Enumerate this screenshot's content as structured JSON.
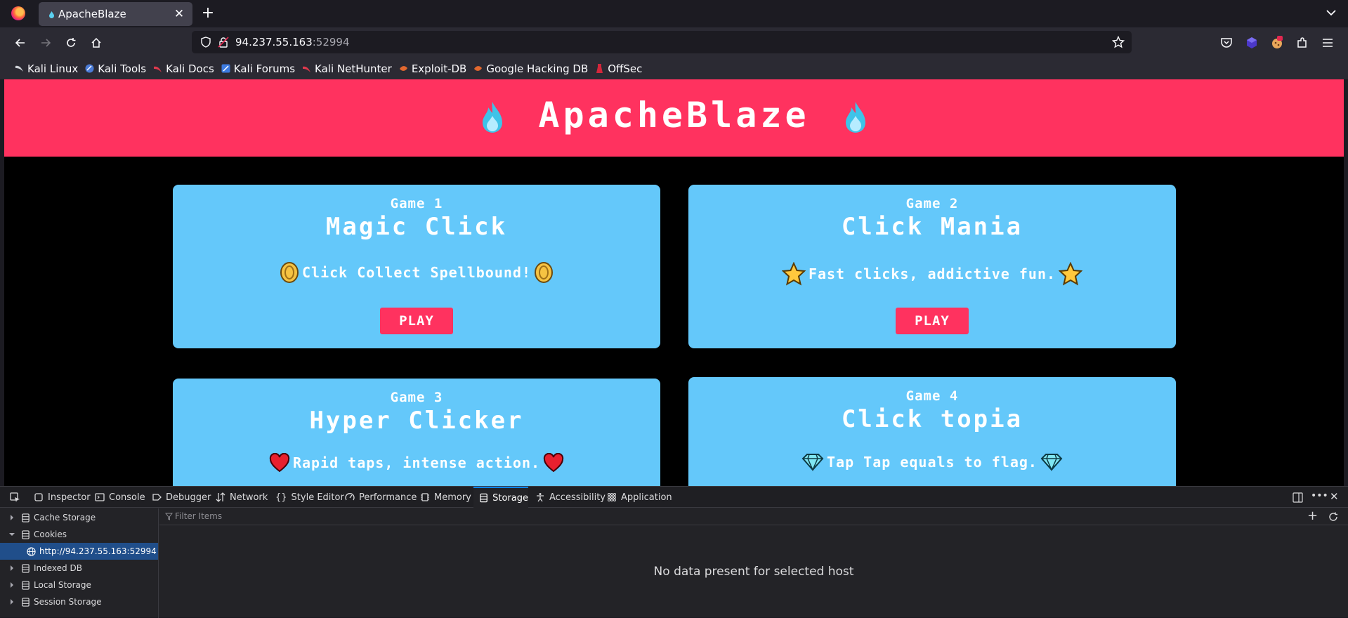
{
  "browser": {
    "tab_title": "ApacheBlaze",
    "url_host": "94.237.55.163",
    "url_port": ":52994"
  },
  "bookmarks": [
    {
      "label": "Kali Linux",
      "icon": "kali-dragon-icon",
      "color": "#cfd2d8"
    },
    {
      "label": "Kali Tools",
      "icon": "kali-tools-icon",
      "color": "#4b7bd6"
    },
    {
      "label": "Kali Docs",
      "icon": "kali-docs-icon",
      "color": "#e0394d"
    },
    {
      "label": "Kali Forums",
      "icon": "kali-forums-icon",
      "color": "#3d7be0"
    },
    {
      "label": "Kali NetHunter",
      "icon": "kali-nethunter-icon",
      "color": "#e0394d"
    },
    {
      "label": "Exploit-DB",
      "icon": "exploit-db-icon",
      "color": "#e2682f"
    },
    {
      "label": "Google Hacking DB",
      "icon": "ghdb-icon",
      "color": "#e2682f"
    },
    {
      "label": "OffSec",
      "icon": "offsec-icon",
      "color": "#d3263b"
    }
  ],
  "site": {
    "title": "ApacheBlaze",
    "colors": {
      "header": "#ff325f",
      "card": "#64c8fa",
      "button": "#ff325f"
    },
    "cards": [
      {
        "num": "Game 1",
        "name": "Magic Click",
        "desc": "Click Collect Spellbound!",
        "icon": "coin-icon",
        "play": "PLAY"
      },
      {
        "num": "Game 2",
        "name": "Click Mania",
        "desc": "Fast clicks, addictive fun.",
        "icon": "star-icon",
        "play": "PLAY"
      },
      {
        "num": "Game 3",
        "name": "Hyper Clicker",
        "desc": "Rapid taps, intense action.",
        "icon": "heart-icon"
      },
      {
        "num": "Game 4",
        "name": "Click topia",
        "desc": "Tap Tap equals to flag.",
        "icon": "diamond-icon"
      }
    ]
  },
  "devtools": {
    "tabs": [
      "Inspector",
      "Console",
      "Debugger",
      "Network",
      "Style Editor",
      "Performance",
      "Memory",
      "Storage",
      "Accessibility",
      "Application"
    ],
    "active_tab": "Storage",
    "tree": [
      {
        "label": "Cache Storage",
        "expanded": false
      },
      {
        "label": "Cookies",
        "expanded": true
      },
      {
        "label": "http://94.237.55.163:52994",
        "child": true,
        "selected": true
      },
      {
        "label": "Indexed DB",
        "expanded": false
      },
      {
        "label": "Local Storage",
        "expanded": false
      },
      {
        "label": "Session Storage",
        "expanded": false
      }
    ],
    "filter_placeholder": "Filter Items",
    "empty_message": "No data present for selected host"
  }
}
